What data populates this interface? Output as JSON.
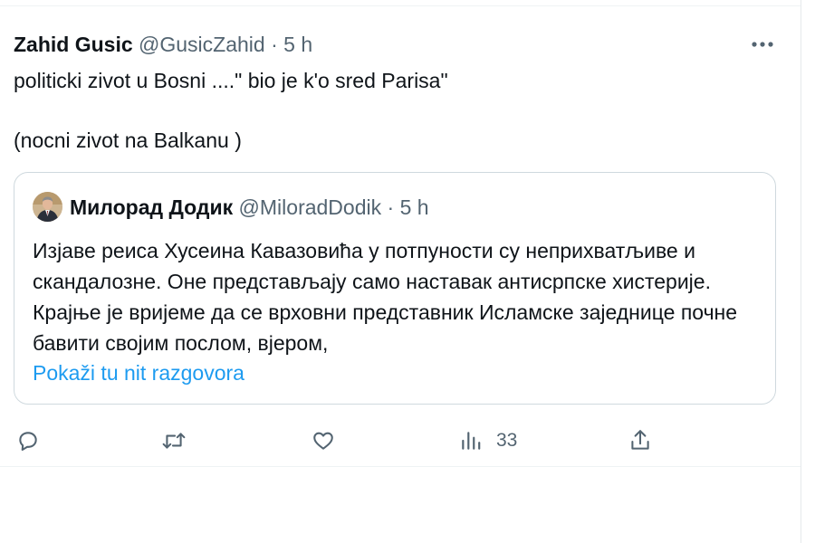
{
  "tweet": {
    "author_name": "Zahid Gusic",
    "handle": "@GusicZahid",
    "separator": "·",
    "time": "5 h",
    "more_label": "···",
    "text": "politicki zivot u Bosni ....\" bio je k'o sred Parisa\"\n\n(nocni zivot na Balkanu )"
  },
  "quoted": {
    "author_name": "Милорад Додик",
    "handle": "@MiloradDodik",
    "separator": "·",
    "time": "5 h",
    "text": "Изјаве реиса Хусеина Кавазовића у потпуности су неприхватљиве и скандалозне. Оне представљају само наставак антисрпске хистерије. Крајње је вријеме да се врховни представник Исламске заједнице почне бавити својим послом, вјером,",
    "thread_link": "Pokaži tu nit razgovora"
  },
  "actions": {
    "views_count": "33"
  },
  "icons": {
    "reply": "reply-icon",
    "repost": "repost-icon",
    "like": "heart-icon",
    "views": "views-icon",
    "share": "share-icon",
    "more": "more-icon"
  },
  "colors": {
    "text": "#0f1419",
    "muted": "#536471",
    "link": "#1d9bf0",
    "border": "#cfd9de"
  }
}
